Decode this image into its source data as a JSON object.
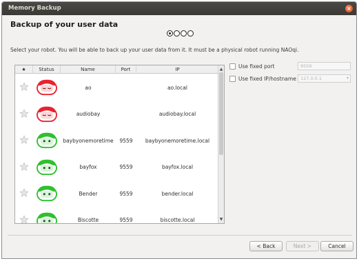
{
  "window": {
    "title": "Memory Backup"
  },
  "wizard": {
    "title": "Backup of your user data",
    "steps": [
      "active",
      "inactive",
      "inactive",
      "inactive"
    ],
    "instructions": "Select your robot. You will be able to back up your user data from it. It must be a physical robot running NAOqi."
  },
  "table": {
    "headers": {
      "star": "★",
      "status": "Status",
      "name": "Name",
      "port": "Port",
      "ip": "IP"
    },
    "rows": [
      {
        "status": "offline",
        "status_color": "#e8232f",
        "name": "ao",
        "port": "",
        "ip": "ao.local"
      },
      {
        "status": "offline",
        "status_color": "#e8232f",
        "name": "audiobay",
        "port": "",
        "ip": "audiobay.local"
      },
      {
        "status": "online",
        "status_color": "#2fc02f",
        "name": "baybyonemoretime",
        "port": "9559",
        "ip": "baybyonemoretime.local"
      },
      {
        "status": "online",
        "status_color": "#2fc02f",
        "name": "bayfox",
        "port": "9559",
        "ip": "bayfox.local"
      },
      {
        "status": "online",
        "status_color": "#2fc02f",
        "name": "Bender",
        "port": "9559",
        "ip": "bender.local"
      },
      {
        "status": "online",
        "status_color": "#2fc02f",
        "name": "Biscotte",
        "port": "9559",
        "ip": "biscotte.local"
      }
    ]
  },
  "options": {
    "fixed_port_label": "Use fixed port",
    "fixed_port_value": "9559",
    "fixed_ip_label": "Use fixed IP/hostname",
    "fixed_ip_value": "127.0.0.1"
  },
  "buttons": {
    "back": "< Back",
    "next": "Next >",
    "cancel": "Cancel"
  },
  "colors": {
    "titlebar": "#3c3b37",
    "close": "#dd4814",
    "offline": "#e8232f",
    "online": "#2fc02f"
  }
}
